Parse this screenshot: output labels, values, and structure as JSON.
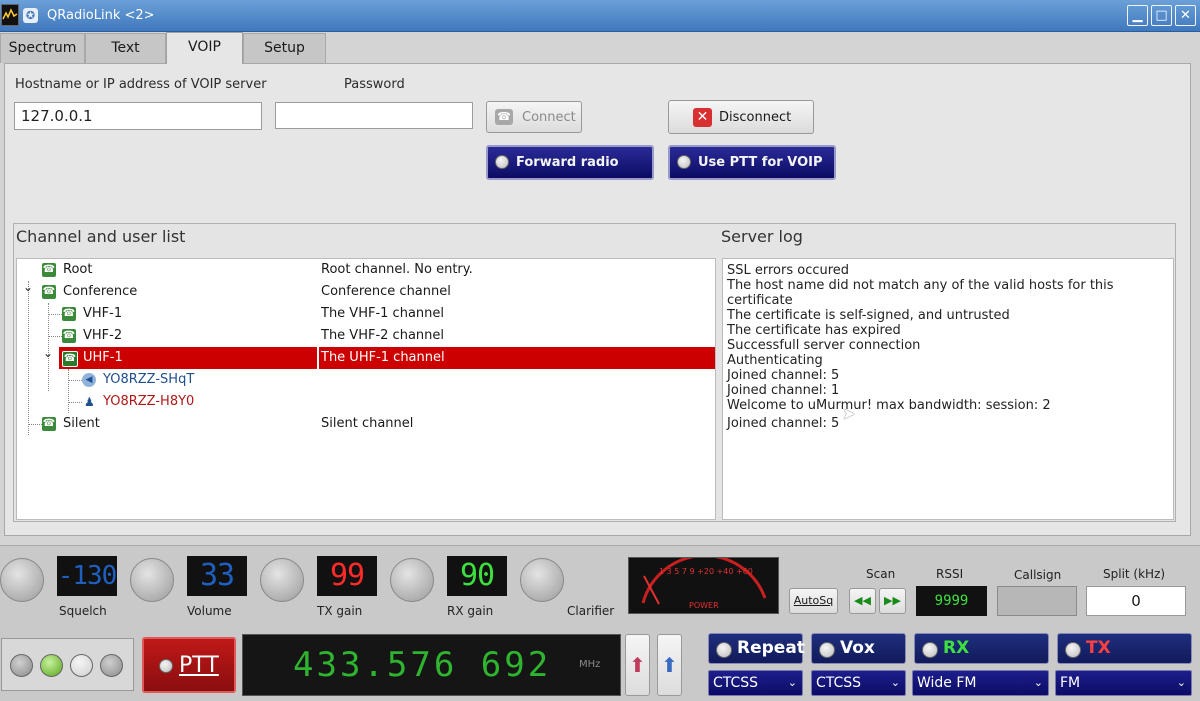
{
  "window": {
    "title": "QRadioLink <2>",
    "menu_glyph": "✪",
    "minimize": "▁",
    "maximize": "□",
    "close": "✕"
  },
  "tabs": [
    {
      "label": "Spectrum",
      "active": false
    },
    {
      "label": "Text",
      "active": false
    },
    {
      "label": "VOIP",
      "active": true
    },
    {
      "label": "Setup",
      "active": false
    }
  ],
  "voip": {
    "host_label": "Hostname or IP address of VOIP server",
    "host_value": "127.0.0.1",
    "password_label": "Password",
    "password_value": "",
    "connect_label": "Connect",
    "disconnect_label": "Disconnect",
    "forward_radio_label": "Forward radio",
    "use_ptt_label": "Use PTT for VOIP"
  },
  "channels": {
    "header": "Channel and user list",
    "rows": [
      {
        "name": "Root",
        "desc": "Root channel. No entry.",
        "kind": "channel"
      },
      {
        "name": "Conference",
        "desc": "Conference channel",
        "kind": "channel",
        "expander": "⌄"
      },
      {
        "name": "VHF-1",
        "desc": "The VHF-1 channel",
        "kind": "channel"
      },
      {
        "name": "VHF-2",
        "desc": "The VHF-2 channel",
        "kind": "channel"
      },
      {
        "name": "UHF-1",
        "desc": "The UHF-1 channel",
        "kind": "channel",
        "selected": true,
        "expander": "⌄"
      },
      {
        "name": "YO8RZZ-SHqT",
        "desc": "",
        "kind": "user",
        "color": "#1f4f8f"
      },
      {
        "name": "YO8RZZ-H8Y0",
        "desc": "",
        "kind": "user",
        "color": "#b01818"
      },
      {
        "name": "Silent",
        "desc": "Silent channel",
        "kind": "channel"
      }
    ]
  },
  "server_log": {
    "header": "Server log",
    "lines": [
      "SSL errors occured",
      "The host name did not match any of the valid hosts for this",
      "certificate",
      "The certificate is self-signed, and untrusted",
      "The certificate has expired",
      "Successfull server connection",
      "Authenticating",
      "Joined channel: 5",
      "Joined channel: 1",
      "Welcome to uMurmur! max bandwidth:  session: 2",
      "Joined channel: 5"
    ]
  },
  "controls": {
    "squelch": {
      "label": "Squelch",
      "value": "-130"
    },
    "volume": {
      "label": "Volume",
      "value": "33"
    },
    "tx_gain": {
      "label": "TX gain",
      "value": "99"
    },
    "rx_gain": {
      "label": "RX gain",
      "value": "90"
    },
    "clarifier": {
      "label": "Clarifier"
    },
    "meter": {
      "scale": "1  3  5  7  9 +20 +40 +60",
      "label": "POWER"
    },
    "autosq_label": "AutoSq",
    "scan_label": "Scan",
    "scan_back": "◀◀",
    "scan_fwd": "▶▶",
    "rssi_label": "RSSI",
    "rssi_value": "9999",
    "callsign_label": "Callsign",
    "callsign_value": "",
    "split_label": "Split (kHz)",
    "split_value": "0",
    "ptt_label": "PTT",
    "frequency": "433.576 692",
    "freq_unit": "MHz",
    "arrow_up_red": "⬆",
    "arrow_up_blue": "⬆",
    "repeat_label": "Repeat",
    "vox_label": "Vox",
    "rx_label": "RX",
    "tx_label": "TX",
    "ctcss_1": "CTCSS",
    "ctcss_2": "CTCSS",
    "rx_mode": "Wide FM",
    "tx_mode": "FM",
    "combo_caret": "⌄",
    "colors": {
      "rx_label": "#3ee03e",
      "tx_label": "#ff4040",
      "lcd_squelch": "#1f5fbf",
      "lcd_volume": "#1f5fbf",
      "lcd_txgain": "#ff2a2a",
      "lcd_rxgain": "#3ce03c",
      "freq_digits": "#2fb42f"
    }
  }
}
